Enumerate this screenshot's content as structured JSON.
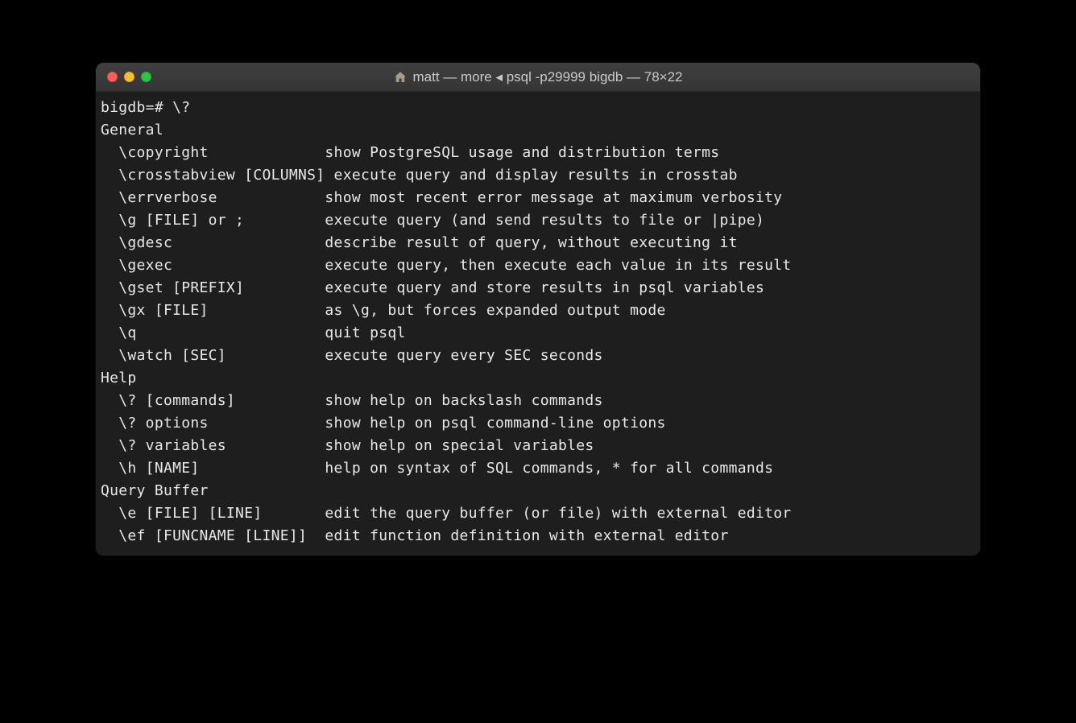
{
  "window": {
    "title": "matt — more ◂ psql -p29999 bigdb — 78×22"
  },
  "lines": {
    "l0": "bigdb=# \\?",
    "l1": "General",
    "l2": "  \\copyright             show PostgreSQL usage and distribution terms",
    "l3": "  \\crosstabview [COLUMNS] execute query and display results in crosstab",
    "l4": "  \\errverbose            show most recent error message at maximum verbosity",
    "l5": "  \\g [FILE] or ;         execute query (and send results to file or |pipe)",
    "l6": "  \\gdesc                 describe result of query, without executing it",
    "l7": "  \\gexec                 execute query, then execute each value in its result",
    "l8": "  \\gset [PREFIX]         execute query and store results in psql variables",
    "l9": "  \\gx [FILE]             as \\g, but forces expanded output mode",
    "l10": "  \\q                     quit psql",
    "l11": "  \\watch [SEC]           execute query every SEC seconds",
    "l12": "",
    "l13": "Help",
    "l14": "  \\? [commands]          show help on backslash commands",
    "l15": "  \\? options             show help on psql command-line options",
    "l16": "  \\? variables           show help on special variables",
    "l17": "  \\h [NAME]              help on syntax of SQL commands, * for all commands",
    "l18": "",
    "l19": "Query Buffer",
    "l20": "  \\e [FILE] [LINE]       edit the query buffer (or file) with external editor",
    "l21": "  \\ef [FUNCNAME [LINE]]  edit function definition with external editor"
  }
}
